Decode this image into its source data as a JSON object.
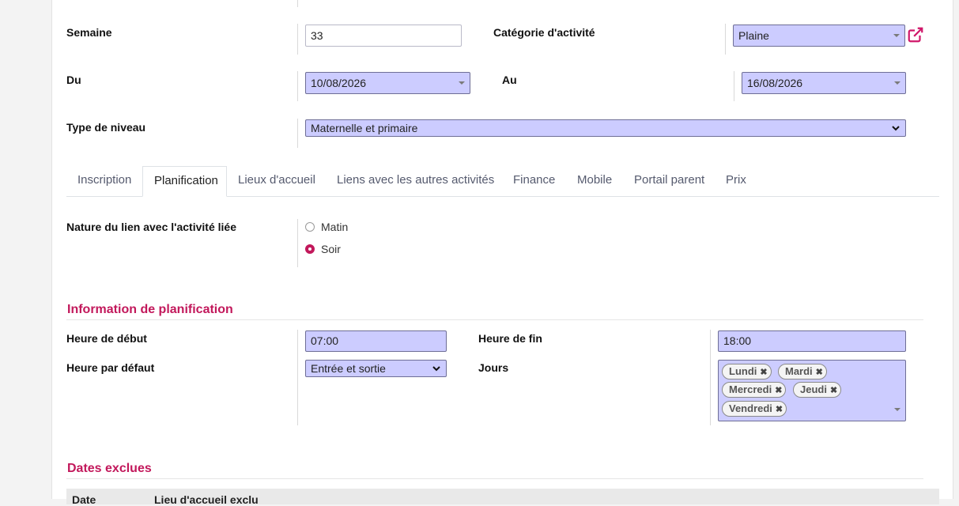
{
  "form": {
    "semaine": {
      "label": "Semaine",
      "value": "33"
    },
    "categorie": {
      "label": "Catégorie d'activité",
      "value": "Plaine"
    },
    "du": {
      "label": "Du",
      "value": "10/08/2026"
    },
    "au": {
      "label": "Au",
      "value": "16/08/2026"
    },
    "type_niveau": {
      "label": "Type de niveau",
      "value": "Maternelle et primaire"
    }
  },
  "tabs": [
    {
      "label": "Inscription"
    },
    {
      "label": "Planification"
    },
    {
      "label": "Lieux d'accueil"
    },
    {
      "label": "Liens avec les autres activités"
    },
    {
      "label": "Finance"
    },
    {
      "label": "Mobile"
    },
    {
      "label": "Portail parent"
    },
    {
      "label": "Prix"
    }
  ],
  "active_tab": "Planification",
  "nature": {
    "label": "Nature du lien avec l'activité liée",
    "options": [
      {
        "label": "Matin",
        "selected": false
      },
      {
        "label": "Soir",
        "selected": true
      }
    ]
  },
  "planification": {
    "title": "Information de planification",
    "heure_debut": {
      "label": "Heure de début",
      "value": "07:00"
    },
    "heure_fin": {
      "label": "Heure de fin",
      "value": "18:00"
    },
    "heure_defaut": {
      "label": "Heure par défaut",
      "value": "Entrée et sortie"
    },
    "jours": {
      "label": "Jours",
      "tags": [
        "Lundi",
        "Mardi",
        "Mercredi",
        "Jeudi",
        "Vendredi"
      ]
    }
  },
  "dates_exclues": {
    "title": "Dates exclues",
    "columns": [
      "Date",
      "Lieu d'accueil exclu"
    ]
  },
  "colors": {
    "accent": "#c2185b",
    "field_bg": "#ccccff"
  },
  "icons": {
    "external_link": "external-link-icon",
    "remove_tag": "close-icon"
  }
}
